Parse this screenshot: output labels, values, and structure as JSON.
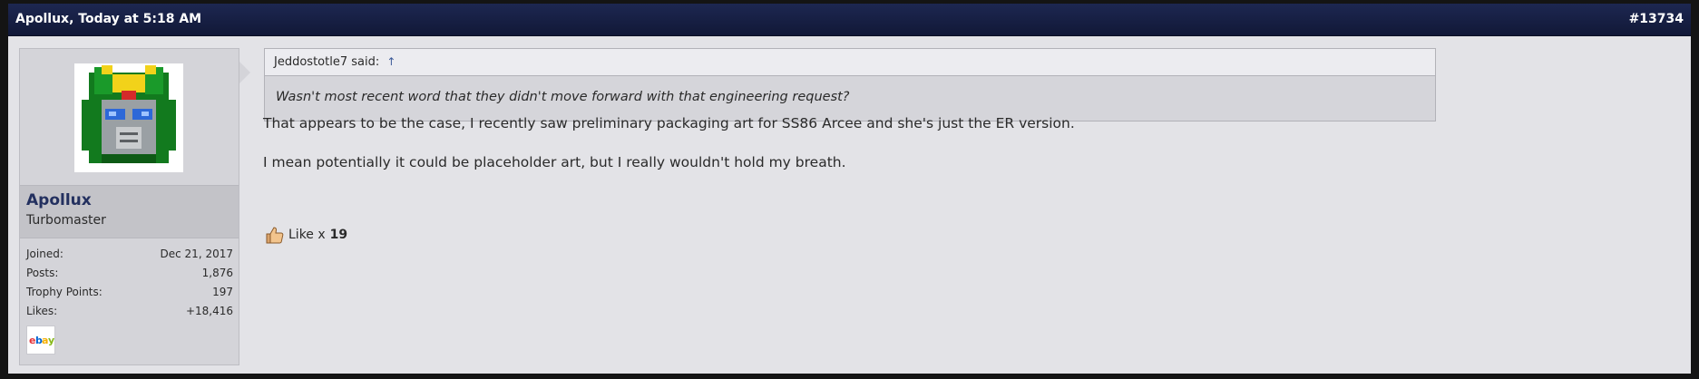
{
  "header": {
    "author_date": "Apollux, Today at 5:18 AM",
    "post_number": "#13734"
  },
  "user": {
    "name": "Apollux",
    "title": "Turbomaster",
    "stats": [
      {
        "label": "Joined:",
        "value": "Dec 21, 2017"
      },
      {
        "label": "Posts:",
        "value": "1,876"
      },
      {
        "label": "Trophy Points:",
        "value": "197"
      },
      {
        "label": "Likes:",
        "value": "+18,416"
      }
    ],
    "badge": "ebay"
  },
  "quote": {
    "author": "Jeddostotle7 said:",
    "jump": "↑",
    "text": "Wasn't most recent word that they didn't move forward with that engineering request?"
  },
  "message": {
    "lines": [
      "That appears to be the case, I recently saw preliminary packaging art for SS86 Arcee and she's just the ER version.",
      "I mean potentially it could be placeholder art, but I really wouldn't hold my breath."
    ]
  },
  "likes": {
    "label": "Like x",
    "count": "19"
  },
  "colors": {
    "header_bg": "#1d2751",
    "post_bg": "#e3e3e7",
    "username": "#23305f"
  },
  "icons": [
    "avatar-image",
    "ebay-icon",
    "thumbs-up-icon"
  ]
}
